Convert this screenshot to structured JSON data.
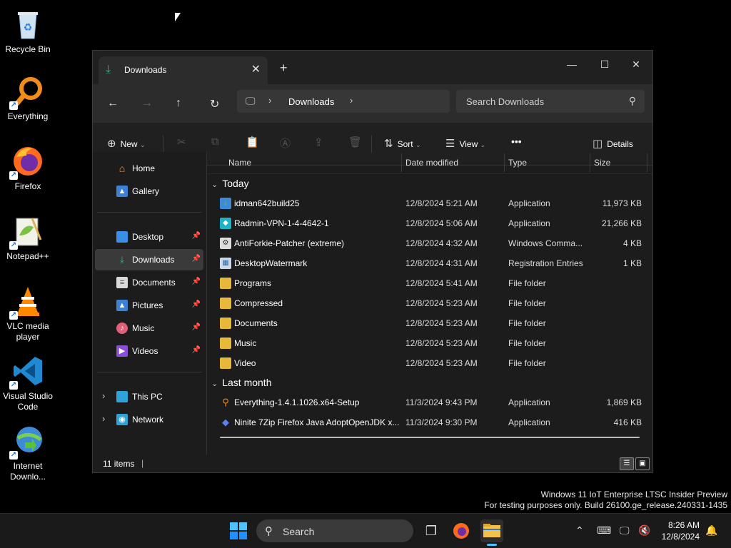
{
  "desktop": {
    "icons": [
      {
        "label": "Recycle Bin",
        "icon": "recycle-bin-icon"
      },
      {
        "label": "Everything",
        "icon": "everything-icon"
      },
      {
        "label": "Firefox",
        "icon": "firefox-icon"
      },
      {
        "label": "Notepad++",
        "icon": "notepad-plus-plus-icon"
      },
      {
        "label": "VLC media player",
        "icon": "vlc-icon"
      },
      {
        "label": "Visual Studio Code",
        "icon": "vscode-icon"
      },
      {
        "label": "Internet Downlo...",
        "icon": "idm-icon"
      }
    ]
  },
  "window": {
    "tab_title": "Downloads",
    "new_tab": "+",
    "address": {
      "crumb": "Downloads"
    },
    "search_placeholder": "Search Downloads",
    "toolbar": {
      "new_label": "New",
      "sort_label": "Sort",
      "view_label": "View",
      "more_label": "•••",
      "details_label": "Details"
    },
    "sidebar": {
      "items": [
        {
          "label": "Home"
        },
        {
          "label": "Gallery"
        },
        {
          "label": "Desktop"
        },
        {
          "label": "Downloads"
        },
        {
          "label": "Documents"
        },
        {
          "label": "Pictures"
        },
        {
          "label": "Music"
        },
        {
          "label": "Videos"
        },
        {
          "label": "This PC"
        },
        {
          "label": "Network"
        }
      ]
    },
    "columns": {
      "name": "Name",
      "date": "Date modified",
      "type": "Type",
      "size": "Size"
    },
    "groups": {
      "today": "Today",
      "last_month": "Last month"
    },
    "files": [
      {
        "name": "idman642build25",
        "date": "12/8/2024 5:21 AM",
        "type": "Application",
        "size": "11,973 KB"
      },
      {
        "name": "Radmin-VPN-1-4-4642-1",
        "date": "12/8/2024 5:06 AM",
        "type": "Application",
        "size": "21,266 KB"
      },
      {
        "name": "AntiForkie-Patcher (extreme)",
        "date": "12/8/2024 4:32 AM",
        "type": "Windows Comma...",
        "size": "4 KB"
      },
      {
        "name": "DesktopWatermark",
        "date": "12/8/2024 4:31 AM",
        "type": "Registration Entries",
        "size": "1 KB"
      },
      {
        "name": "Programs",
        "date": "12/8/2024 5:41 AM",
        "type": "File folder",
        "size": ""
      },
      {
        "name": "Compressed",
        "date": "12/8/2024 5:23 AM",
        "type": "File folder",
        "size": ""
      },
      {
        "name": "Documents",
        "date": "12/8/2024 5:23 AM",
        "type": "File folder",
        "size": ""
      },
      {
        "name": "Music",
        "date": "12/8/2024 5:23 AM",
        "type": "File folder",
        "size": ""
      },
      {
        "name": "Video",
        "date": "12/8/2024 5:23 AM",
        "type": "File folder",
        "size": ""
      },
      {
        "name": "Everything-1.4.1.1026.x64-Setup",
        "date": "11/3/2024 9:43 PM",
        "type": "Application",
        "size": "1,869 KB"
      },
      {
        "name": "Ninite 7Zip Firefox Java AdoptOpenJDK x...",
        "date": "11/3/2024 9:30 PM",
        "type": "Application",
        "size": "416 KB"
      }
    ],
    "status": {
      "count": "11 items"
    }
  },
  "watermark": {
    "line1": "Windows 11 IoT Enterprise LTSC Insider Preview",
    "line2": "For testing purposes only. Build 26100.ge_release.240331-1435"
  },
  "taskbar": {
    "search_placeholder": "Search",
    "time": "8:26 AM",
    "date": "12/8/2024"
  },
  "colors": {
    "accent": "#0078d4",
    "folder": "#e8b83a",
    "window_bg": "#1c1c1c"
  }
}
